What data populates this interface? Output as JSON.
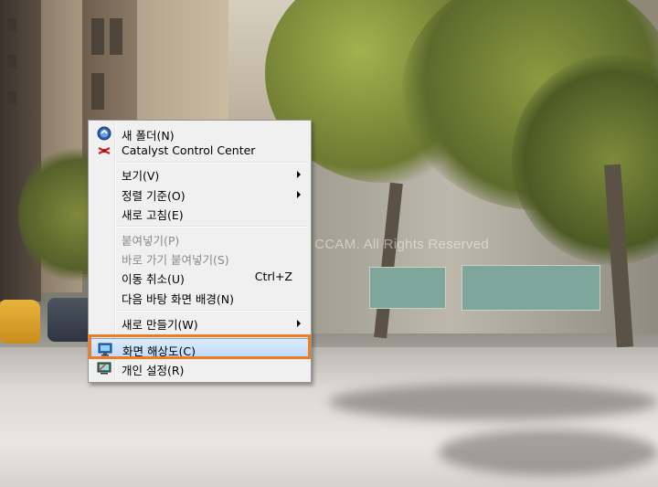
{
  "watermark": "Copyright © 2015 by CCAM. All Rights Reserved",
  "context_menu": {
    "items": [
      {
        "label": "새 폴더(N)",
        "icon": "new-folder-icon"
      },
      {
        "label": "Catalyst Control Center",
        "icon": "catalyst-icon"
      },
      {
        "label": "보기(V)",
        "submenu": true
      },
      {
        "label": "정렬 기준(O)",
        "submenu": true
      },
      {
        "label": "새로 고침(E)"
      },
      {
        "label": "붙여넣기(P)",
        "disabled": true
      },
      {
        "label": "바로 가기 붙여넣기(S)",
        "disabled": true
      },
      {
        "label": "이동 취소(U)",
        "shortcut": "Ctrl+Z"
      },
      {
        "label": "다음 바탕 화면 배경(N)"
      },
      {
        "label": "새로 만들기(W)",
        "submenu": true
      },
      {
        "label": "화면 해상도(C)",
        "icon": "screen-resolution-icon",
        "highlighted": true
      },
      {
        "label": "개인 설정(R)",
        "icon": "personalize-icon"
      }
    ]
  },
  "colors": {
    "menu_background": "#f0f0f0",
    "highlight_border": "#7da2ce",
    "focus_outline": "#ee7d22"
  }
}
